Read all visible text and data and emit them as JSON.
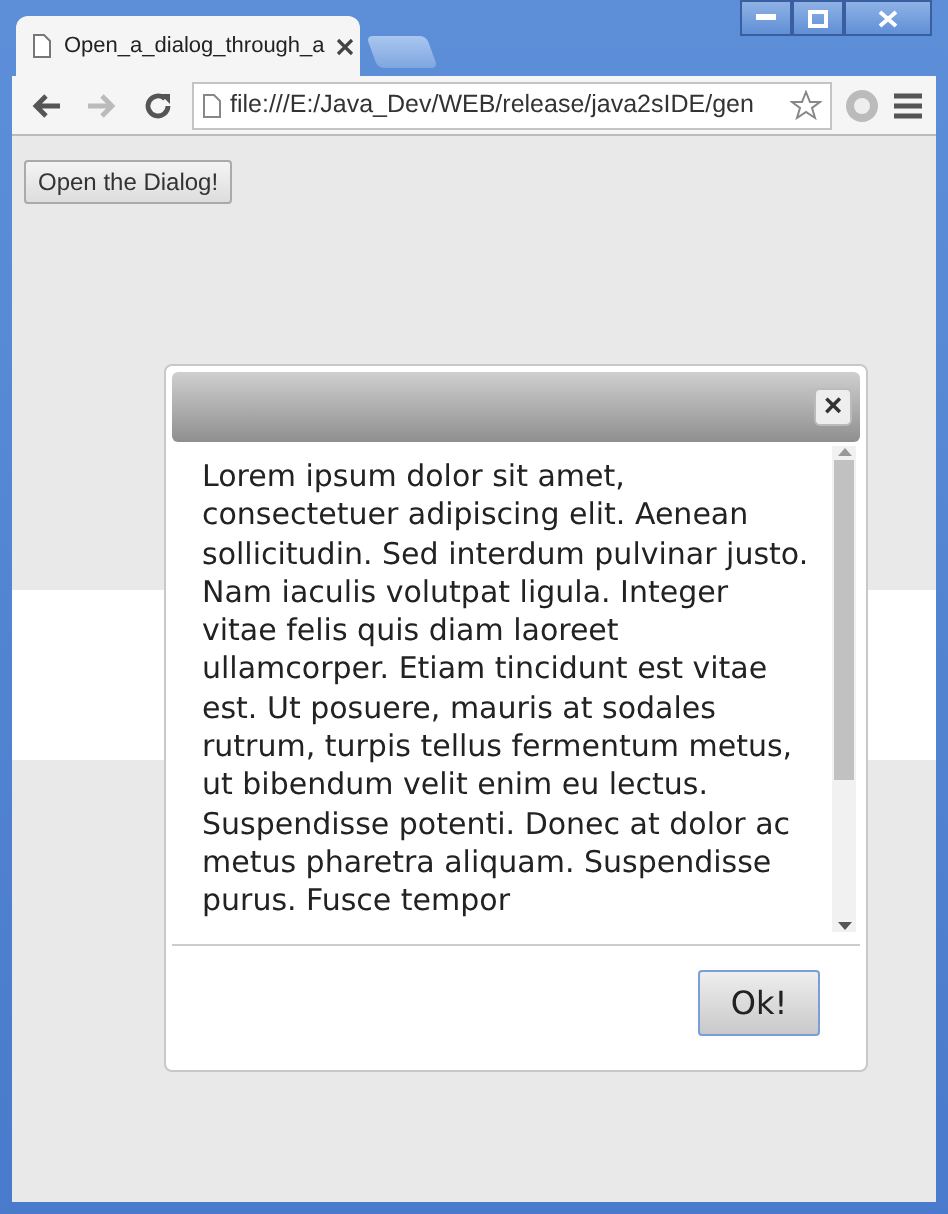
{
  "tabs": [
    {
      "label": "Open_a_dialog_through_a",
      "selected": true
    }
  ],
  "nav_buttons": [
    {
      "kind": "back",
      "disabled": false
    },
    {
      "kind": "forward",
      "disabled": true
    },
    {
      "kind": "reload",
      "disabled": false
    }
  ],
  "address_bar": {
    "url": "file:///E:/Java_Dev/WEB/release/java2sIDE/gen"
  },
  "page": {
    "open_button": "Open the Dialog!"
  },
  "dialog": {
    "close_symbol": "×",
    "body": "Lorem ipsum dolor sit amet, consectetuer adipiscing elit. Aenean sollicitudin. Sed interdum pulvinar justo. Nam iaculis volutpat ligula. Integer vitae felis quis diam laoreet ullamcorper. Etiam tincidunt est vitae est. Ut posuere, mauris at sodales rutrum, turpis tellus fermentum metus, ut bibendum velit enim eu lectus. Suspendisse potenti. Donec at dolor ac metus pharetra aliquam. Suspendisse purus. Fusce tempor",
    "ok_button": "Ok!"
  }
}
